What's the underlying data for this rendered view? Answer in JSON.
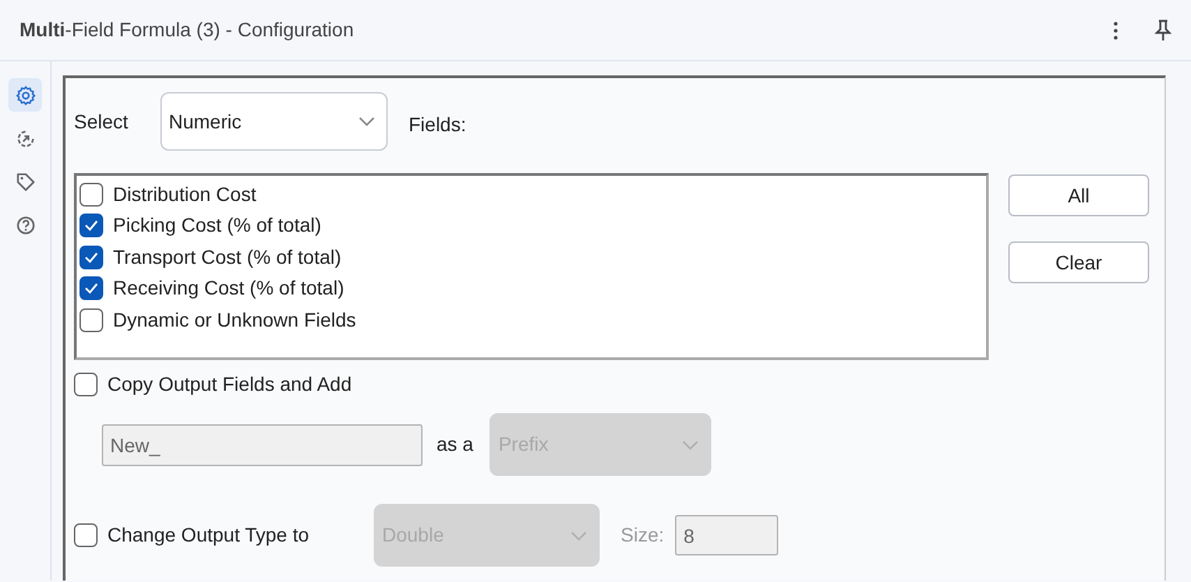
{
  "header": {
    "title": "**Multi**-Field Formula (3) - Configuration"
  },
  "sidebar": {
    "items": [
      {
        "kind": "settings",
        "selected": true
      },
      {
        "kind": "connection",
        "selected": false
      },
      {
        "kind": "tag",
        "selected": false
      },
      {
        "kind": "help",
        "selected": false
      }
    ]
  },
  "select": {
    "label": "Select",
    "value": "Numeric"
  },
  "fields_label": "Fields:",
  "fields": [
    {
      "label": "Distribution Cost",
      "checked": false
    },
    {
      "label": "Picking Cost (% of total)",
      "checked": true
    },
    {
      "label": "Transport Cost (% of total)",
      "checked": true
    },
    {
      "label": "Receiving Cost (% of total)",
      "checked": true
    },
    {
      "label": "Dynamic or Unknown Fields",
      "checked": false
    }
  ],
  "buttons": [
    "All",
    "Clear"
  ],
  "copy_output": {
    "label": "Copy Output Fields and Add",
    "checked": false
  },
  "name_field": {
    "value": "New_",
    "disabled": true
  },
  "as_label": "as a",
  "position_select": {
    "value": "Prefix",
    "disabled": true
  },
  "change_type": {
    "label": "Change Output Type to",
    "checked": false
  },
  "type_select": {
    "value": "Double",
    "disabled": true
  },
  "size_label": "Size:",
  "size_field": {
    "value": "8",
    "disabled": true
  }
}
